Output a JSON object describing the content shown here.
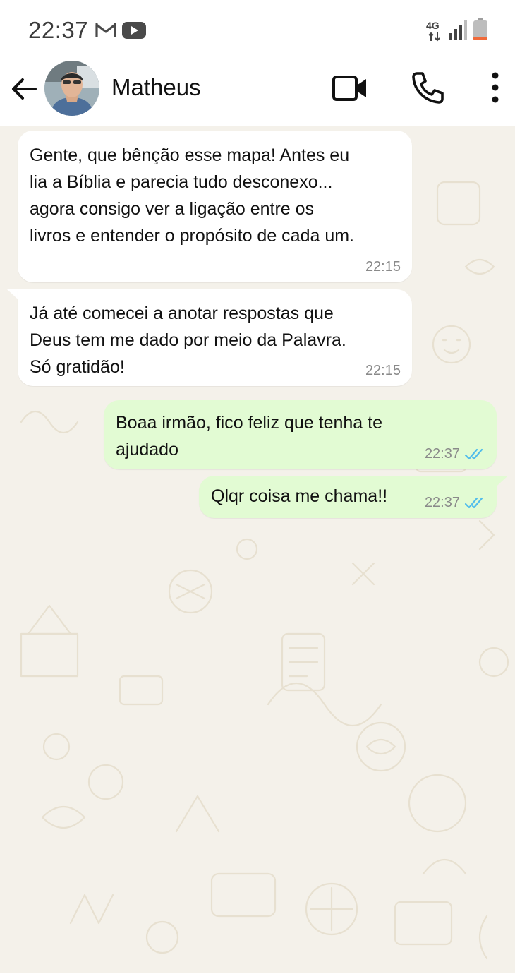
{
  "status_bar": {
    "time": "22:37",
    "app_icons": [
      "gmail-icon",
      "youtube-icon"
    ],
    "network": "4G",
    "signal_icon": "signal-icon",
    "battery_icon": "battery-icon"
  },
  "header": {
    "contact_name": "Matheus",
    "back_icon": "arrow-left-icon",
    "video_icon": "video-camera-icon",
    "call_icon": "phone-icon",
    "menu_icon": "more-vertical-icon"
  },
  "messages": [
    {
      "direction": "in",
      "text": "Gente, que bênção esse mapa! Antes eu\nlia a Bíblia e parecia tudo desconexo...\nagora consigo ver a ligação entre os\nlivros e entender o propósito de cada um.",
      "time": "22:15"
    },
    {
      "direction": "in",
      "text": "Já até comecei a anotar respostas que\nDeus tem me dado por meio da Palavra.\nSó gratidão!",
      "time": "22:15"
    },
    {
      "direction": "out",
      "text": "Boaa irmão, fico feliz que tenha te\najudado",
      "time": "22:37",
      "status_icon": "double-check-icon"
    },
    {
      "direction": "out",
      "text": "Qlqr coisa me chama!!",
      "time": "22:37",
      "status_icon": "double-check-icon"
    }
  ],
  "colors": {
    "chat_background": "#f4f1ea",
    "incoming_bubble": "#ffffff",
    "outgoing_bubble": "#e2fbd3",
    "read_check": "#53bdeb",
    "battery_low": "#f06a3a"
  }
}
